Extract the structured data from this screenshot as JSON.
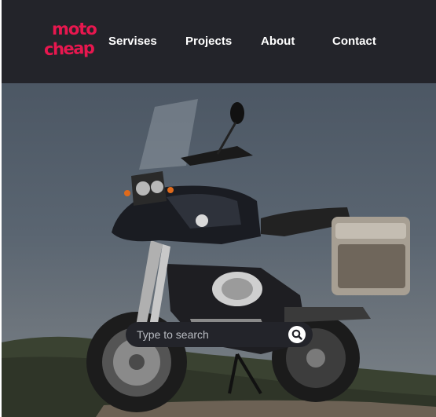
{
  "logo": {
    "line1": "moto",
    "line2": "cheap"
  },
  "nav": {
    "services": "Servises",
    "projects": "Projects",
    "about": "About",
    "contact": "Contact"
  },
  "search": {
    "placeholder": "Type to search",
    "value": ""
  },
  "colors": {
    "header_bg": "#23242a",
    "brand": "#e8174f",
    "nav_text": "#ffffff"
  },
  "icons": {
    "search": "search-icon"
  }
}
